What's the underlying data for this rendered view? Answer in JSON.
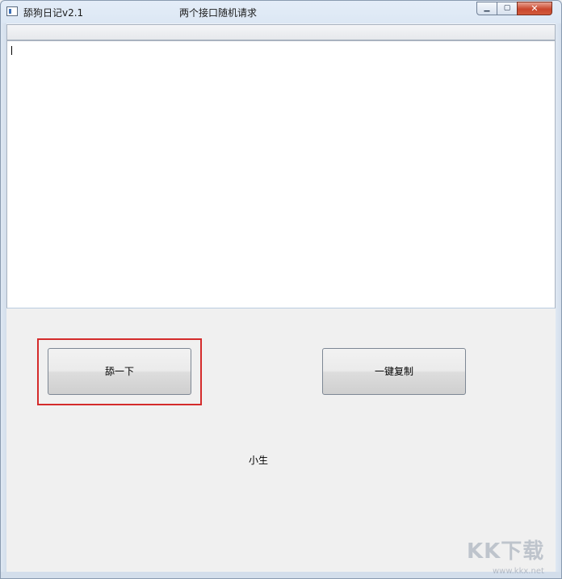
{
  "window": {
    "title": "舔狗日记v2.1",
    "subtitle": "两个接口随机请求",
    "controls": {
      "minimize_glyph": "▁",
      "maximize_glyph": "▢",
      "close_glyph": "✕"
    }
  },
  "editor": {
    "value": ""
  },
  "buttons": {
    "lick_label": "舔一下",
    "copy_label": "一键复制"
  },
  "footer": {
    "author": "小生"
  },
  "overlay": {
    "watermark": "KK下载",
    "watermark_url": "www.kkx.net"
  },
  "colors": {
    "highlight_border": "#d42b2b",
    "close_button": "#c9472d"
  }
}
